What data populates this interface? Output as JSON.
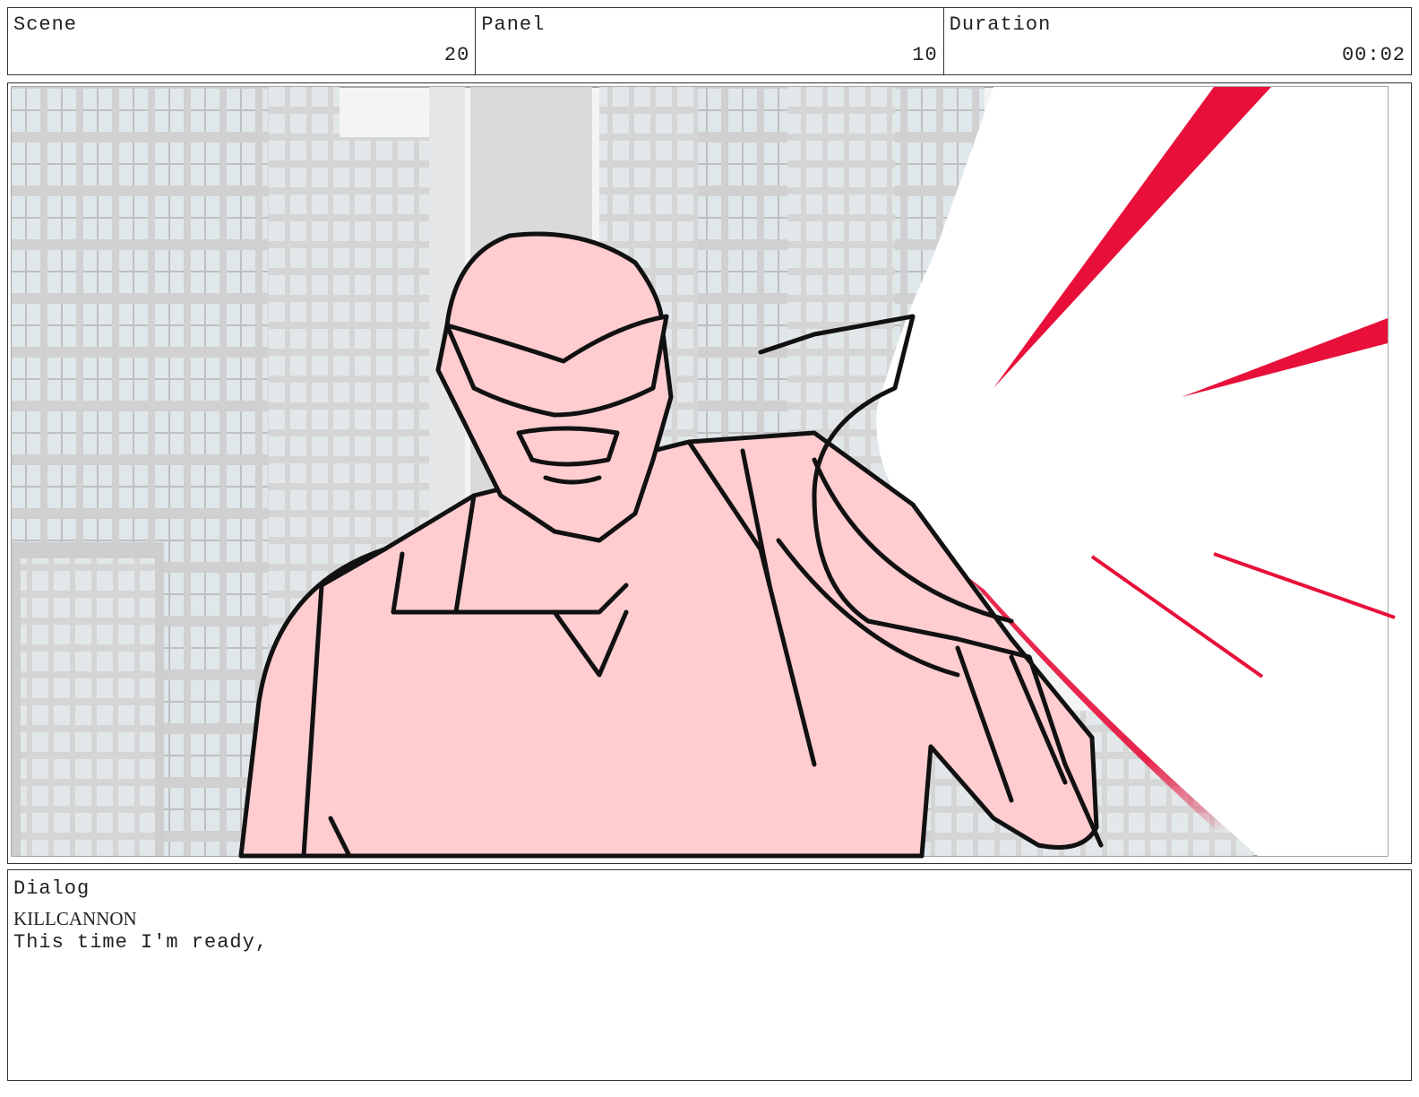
{
  "header": {
    "scene_label": "Scene",
    "scene_value": "20",
    "panel_label": "Panel",
    "panel_value": "10",
    "duration_label": "Duration",
    "duration_value": "00:02"
  },
  "dialog": {
    "label": "Dialog",
    "speaker": "KILLCANNON",
    "line": "This time I'm ready,"
  },
  "colors": {
    "character_fill": "#ffcccf",
    "laser_red": "#e8103a",
    "building_gray": "#d9d9d9",
    "window_blue": "#dfe7ea"
  }
}
